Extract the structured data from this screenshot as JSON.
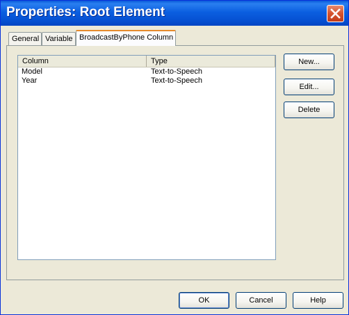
{
  "window": {
    "title": "Properties: Root Element"
  },
  "tabs": [
    {
      "label": "General"
    },
    {
      "label": "Variable"
    },
    {
      "label": "BroadcastByPhone Column"
    }
  ],
  "list": {
    "columns": [
      "Column",
      "Type"
    ],
    "rows": [
      {
        "column": "Model",
        "type": "Text-to-Speech"
      },
      {
        "column": "Year",
        "type": "Text-to-Speech"
      }
    ]
  },
  "side_buttons": {
    "new": "New...",
    "edit": "Edit...",
    "delete": "Delete"
  },
  "footer_buttons": {
    "ok": "OK",
    "cancel": "Cancel",
    "help": "Help"
  }
}
